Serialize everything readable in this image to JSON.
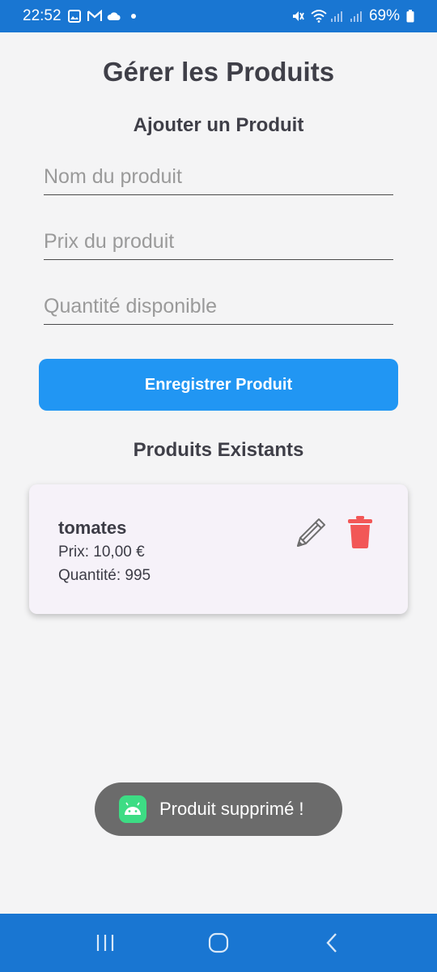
{
  "status_bar": {
    "time": "22:52",
    "battery": "69%",
    "left_icons": [
      "image-icon",
      "gmail-icon",
      "cloud-icon"
    ],
    "right_icons": [
      "mute-icon",
      "wifi-icon",
      "signal-icon",
      "battery-icon"
    ]
  },
  "page": {
    "title": "Gérer les Produits",
    "add_section_title": "Ajouter un Produit",
    "existing_section_title": "Produits Existants"
  },
  "form": {
    "name_placeholder": "Nom du produit",
    "name_value": "",
    "price_placeholder": "Prix du produit",
    "price_value": "",
    "quantity_placeholder": "Quantité disponible",
    "quantity_value": "",
    "save_label": "Enregistrer Produit"
  },
  "products": [
    {
      "name": "tomates",
      "price": "Prix: 10,00 €",
      "quantity": "Quantité: 995"
    }
  ],
  "toast": {
    "message": "Produit supprimé !"
  },
  "colors": {
    "primary": "#2196f3",
    "status_bar": "#1976d2",
    "delete": "#f25757",
    "background": "#f4f4f5",
    "card": "#f6f2f9"
  }
}
